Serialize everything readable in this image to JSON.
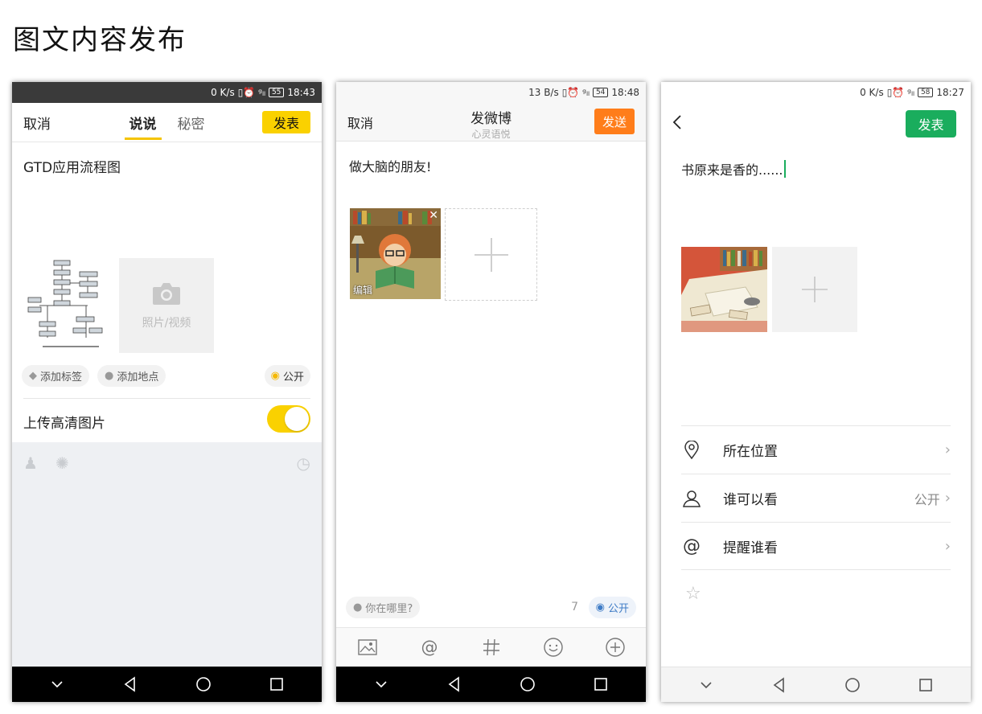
{
  "page_title": "图文内容发布",
  "phone1": {
    "status": {
      "speed": "0 K/s",
      "battery": "55",
      "time": "18:43"
    },
    "cancel": "取消",
    "tabs": [
      "说说",
      "秘密"
    ],
    "publish": "发表",
    "text": "GTD应用流程图",
    "add_media": "照片/视频",
    "chips": {
      "tag": "添加标签",
      "location": "添加地点",
      "visibility": "公开"
    },
    "hd_upload": "上传高清图片",
    "hd_upload_on": true,
    "colors": {
      "accent": "#fad100"
    }
  },
  "phone2": {
    "status": {
      "speed": "13 B/s",
      "battery": "54",
      "time": "18:48"
    },
    "cancel": "取消",
    "title": "发微博",
    "subtitle": "心灵语悦",
    "send": "发送",
    "text": "做大脑的朋友!",
    "image_edit": "编辑",
    "location": "你在哪里?",
    "count": "7",
    "visibility": "公开",
    "toolbar": [
      "image-icon",
      "at-icon",
      "hashtag-icon",
      "emoji-icon",
      "plus-icon"
    ],
    "colors": {
      "accent": "#ff7d1a",
      "link": "#3f7cc6"
    }
  },
  "phone3": {
    "status": {
      "speed": "0 K/s",
      "battery": "58",
      "time": "18:27"
    },
    "publish": "发表",
    "text": "书原来是香的......",
    "rows": [
      {
        "label": "所在位置",
        "value": ""
      },
      {
        "label": "谁可以看",
        "value": "公开"
      },
      {
        "label": "提醒谁看",
        "value": ""
      }
    ],
    "colors": {
      "accent": "#1aad5d"
    }
  }
}
